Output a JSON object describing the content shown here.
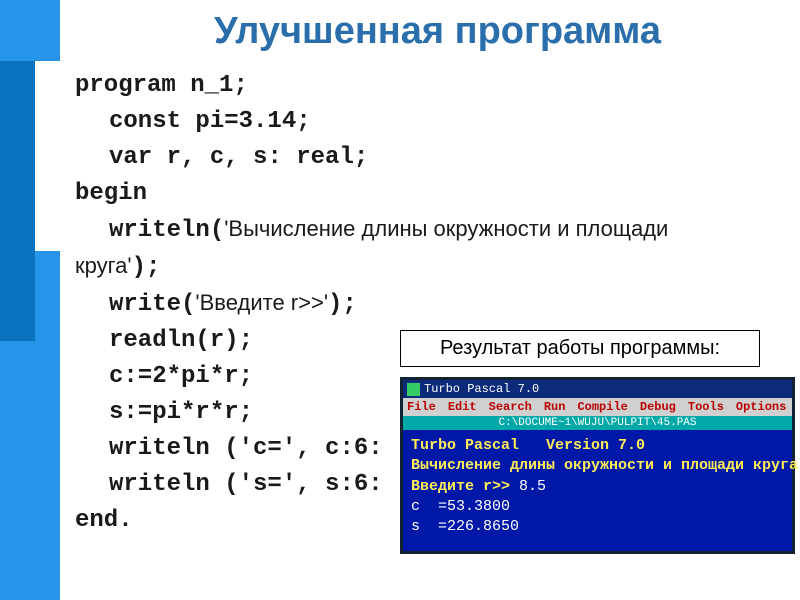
{
  "title": "Улучшенная программа",
  "code": {
    "l1_kw": "program",
    "l1_rest": " n_1;",
    "l2_kw": "const",
    "l2_rest": " pi=3.14;",
    "l3_kw": "var",
    "l3_rest": " r, c, s: real;",
    "l4_kw": "begin",
    "l5a": "writeln(",
    "l5_str": "'Вычисление длины окружности и площади",
    "l6_str": "круга'",
    "l6b": ");",
    "l7a": "write(",
    "l7_str": "'Введите r>>'",
    "l7b": ");",
    "l8": "readln(r);",
    "l9": "c:=2*pi*r;",
    "l10": "s:=pi*r*r;",
    "l11": "writeln ('c=', c:6:",
    "l12": "writeln ('s=', s:6:",
    "l13_kw": "end",
    "l13_rest": "."
  },
  "result_label": "Результат работы программы:",
  "terminal": {
    "title": "Turbo Pascal 7.0",
    "menu": {
      "file": "File",
      "edit": "Edit",
      "search": "Search",
      "run": "Run",
      "compile": "Compile",
      "debug": "Debug",
      "tools": "Tools",
      "options": "Options"
    },
    "path": "C:\\DOCUME~1\\WUJU\\PULPIT\\45.PAS",
    "out1": "Turbo Pascal   Version 7.0",
    "out2": "Вычисление длины окружности и площади круга",
    "out3a": "Введите r>>",
    "out3b": " 8.5",
    "out4": "c  =53.3800",
    "out5": "s  =226.8650"
  }
}
